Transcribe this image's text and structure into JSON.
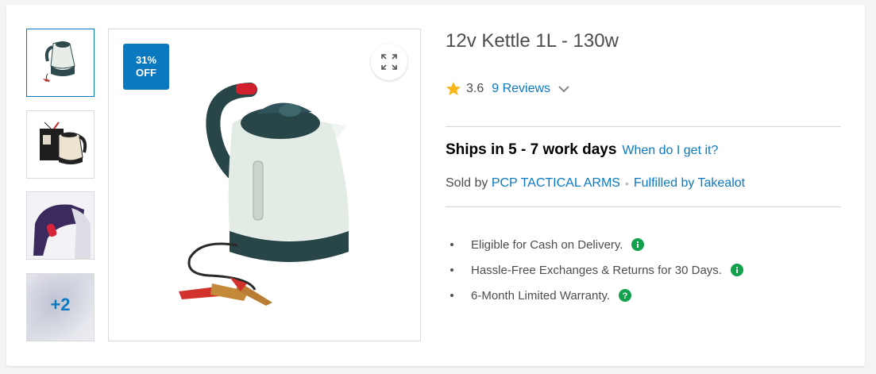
{
  "product": {
    "title": "12v Kettle 1L - 130w",
    "discount_badge": {
      "percent": "31%",
      "label": "OFF"
    },
    "more_images_label": "+2"
  },
  "rating": {
    "score": "3.6",
    "reviews_label": "9 Reviews",
    "star_color": "#f8b617"
  },
  "shipping": {
    "ships_text": "Ships in 5 - 7 work days",
    "when_link": "When do I get it?"
  },
  "seller": {
    "sold_by_prefix": "Sold by",
    "seller_name": "PCP TACTICAL ARMS",
    "separator": "•",
    "fulfilled": "Fulfilled by Takealot"
  },
  "benefits": [
    {
      "text": "Eligible for Cash on Delivery.",
      "icon": "info-icon"
    },
    {
      "text": "Hassle-Free Exchanges & Returns for 30 Days.",
      "icon": "info-icon"
    },
    {
      "text": "6-Month Limited Warranty.",
      "icon": "help-icon"
    }
  ],
  "colors": {
    "accent_blue": "#0b79bf",
    "info_green": "#10a14a",
    "text_gray": "#4d4d4d"
  }
}
